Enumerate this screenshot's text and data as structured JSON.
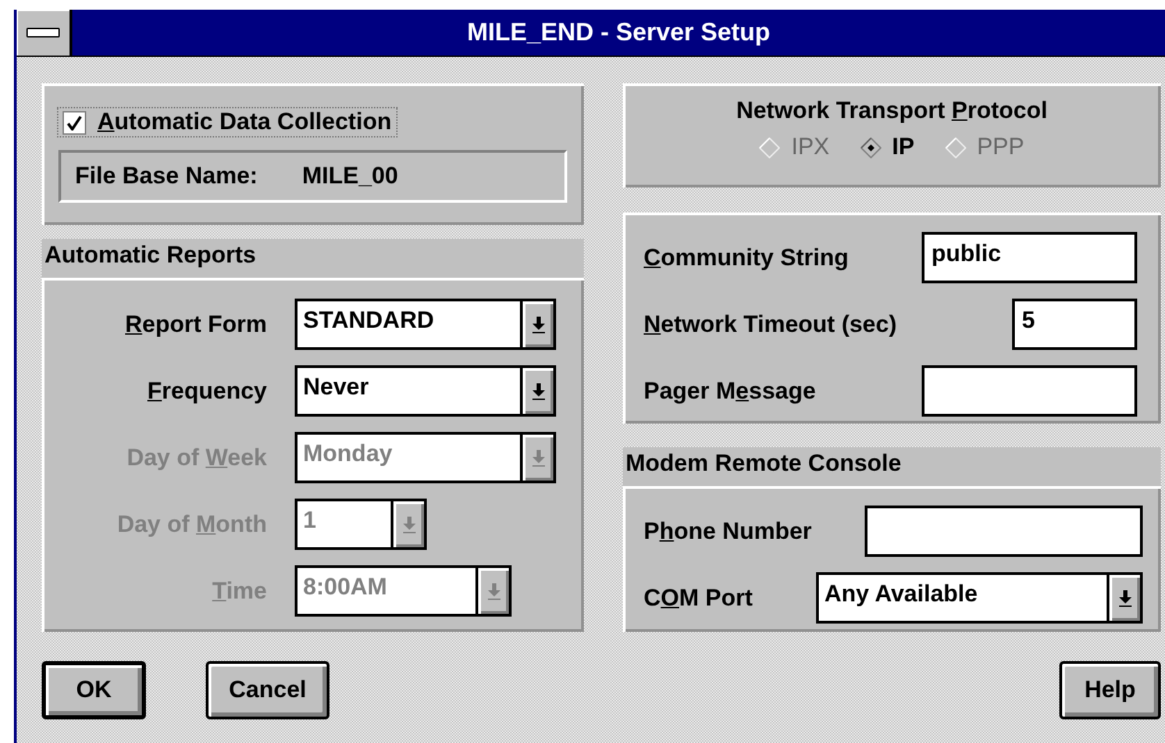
{
  "window": {
    "title": "MILE_END - Server Setup"
  },
  "data_collection": {
    "checkbox": {
      "access_key": "A",
      "label_end": "utomatic Data Collection",
      "checked": true
    },
    "file_base_name": {
      "label": "File Base Name:",
      "value": "MILE_00"
    }
  },
  "automatic_reports": {
    "title": "Automatic Reports",
    "fields": [
      {
        "access_key": "R",
        "label_end": "eport Form",
        "value": "STANDARD",
        "disabled": false
      },
      {
        "access_key": "F",
        "label_end": "requency",
        "value": "Never",
        "disabled": false
      },
      {
        "label_start": "Day of ",
        "access_key": "W",
        "label_end": "eek",
        "value": "Monday",
        "disabled": true
      },
      {
        "label_start": "Day of ",
        "access_key": "M",
        "label_end": "onth",
        "value": "1",
        "disabled": true
      },
      {
        "access_key": "T",
        "label_end": "ime",
        "value": "8:00AM",
        "disabled": true
      }
    ]
  },
  "network_transport_protocol": {
    "title_start": "Network Transport ",
    "access_key": "P",
    "title_end": "rotocol",
    "options": [
      {
        "label": "IPX",
        "selected": false,
        "disabled": true
      },
      {
        "label": "IP",
        "selected": true,
        "disabled": false
      },
      {
        "label": "PPP",
        "selected": false,
        "disabled": true
      }
    ]
  },
  "network": {
    "fields": [
      {
        "access_key": "C",
        "label_end": "ommunity String",
        "value": "public"
      },
      {
        "access_key": "N",
        "label_end": "etwork Timeout (sec)",
        "value": "5"
      },
      {
        "label_start": "Pager M",
        "access_key": "e",
        "label_end": "ssage"
      }
    ]
  },
  "modem_remote_console": {
    "title": "Modem Remote Console",
    "fields": [
      {
        "kind": "field",
        "label_start": "P",
        "access_key": "h",
        "label_end": "one Number"
      },
      {
        "kind": "combo",
        "label_start": "C",
        "access_key": "O",
        "label_end": "M Port",
        "value": "Any Available"
      }
    ]
  },
  "buttons": [
    {
      "label": "OK",
      "default": true
    },
    {
      "label": "Cancel",
      "default": false
    },
    {
      "label": "Help",
      "default": false
    }
  ]
}
